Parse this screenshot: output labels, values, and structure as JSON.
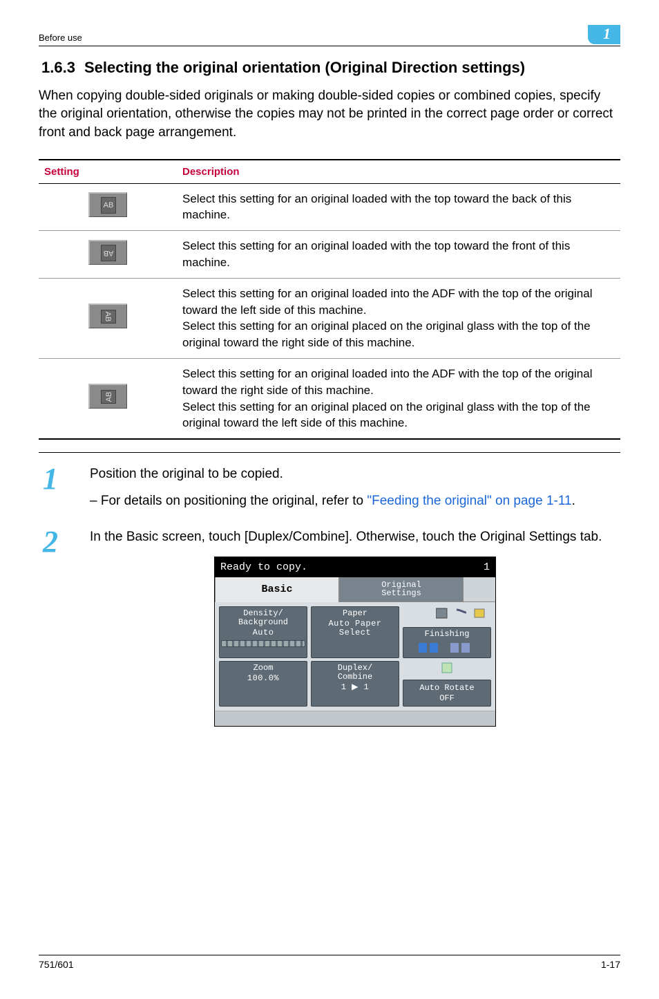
{
  "header": {
    "breadcrumb": "Before use",
    "chapter": "1"
  },
  "section": {
    "number": "1.6.3",
    "title": "Selecting the original orientation (Original Direction settings)"
  },
  "intro": "When copying double-sided originals or making double-sided copies or combined copies, specify the original orientation, otherwise the copies may not be printed in the correct page order or correct front and back page arrangement.",
  "table": {
    "headers": {
      "setting": "Setting",
      "description": "Description"
    },
    "rows": [
      {
        "icon": "AB",
        "rot": "rot0",
        "desc": "Select this setting for an original loaded with the top toward the back of this machine."
      },
      {
        "icon": "AB",
        "rot": "rot180",
        "desc": "Select this setting for an original loaded with the top toward the front of this machine."
      },
      {
        "icon": "AB",
        "rot": "rot90",
        "desc": "Select this setting for an original loaded into the ADF with the top of the original toward the left side of this machine.\nSelect this setting for an original placed on the original glass with the top of the original toward the right side of this machine."
      },
      {
        "icon": "AB",
        "rot": "rot270",
        "desc": "Select this setting for an original loaded into the ADF with the top of the original toward the right side of this machine.\nSelect this setting for an original placed on the original glass with the top of the original toward the left side of this machine."
      }
    ]
  },
  "steps": {
    "s1": {
      "num": "1",
      "text": "Position the original to be copied.",
      "sub_prefix": "– For details on positioning the original, refer to ",
      "link": "\"Feeding the original\" on page 1-11",
      "sub_suffix": "."
    },
    "s2": {
      "num": "2",
      "text": "In the Basic screen, touch [Duplex/Combine]. Otherwise, touch the Original Settings tab."
    }
  },
  "screen": {
    "status": "Ready to copy.",
    "counter": "1",
    "tab_basic": "Basic",
    "tab_original": "Original\nSettings",
    "density_label": "Density/\nBackground",
    "density_value": "Auto",
    "paper_label": "Paper",
    "paper_value": "Auto Paper\nSelect",
    "finishing_label": "Finishing",
    "zoom_label": "Zoom",
    "zoom_value": "100.0%",
    "duplex_label": "Duplex/\nCombine",
    "duplex_value": "1 ▶ 1",
    "auto_rotate": "Auto Rotate\nOFF"
  },
  "footer": {
    "model": "751/601",
    "page": "1-17"
  }
}
